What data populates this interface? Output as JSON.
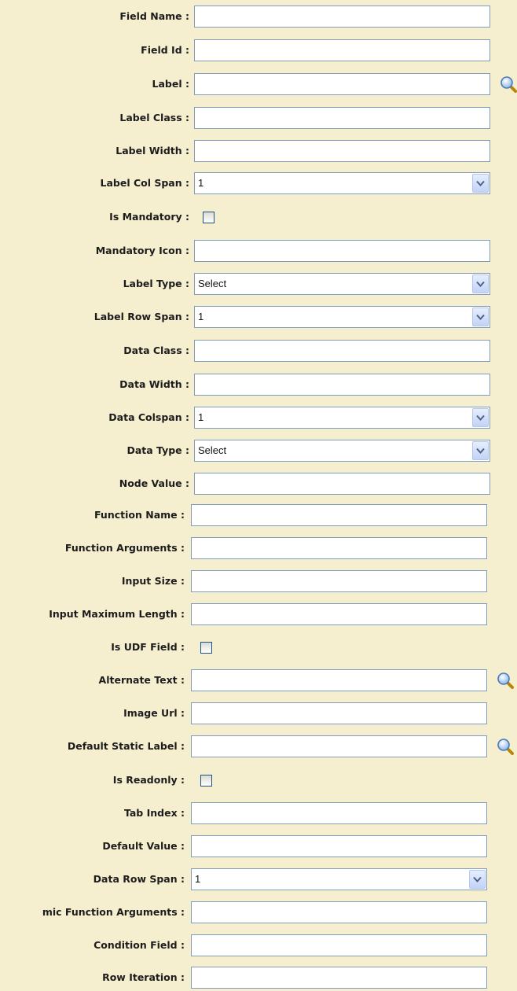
{
  "form": {
    "field_name": {
      "label": "Field Name :",
      "value": ""
    },
    "field_id": {
      "label": "Field Id :",
      "value": ""
    },
    "label": {
      "label": "Label :",
      "value": ""
    },
    "label_class": {
      "label": "Label Class :",
      "value": ""
    },
    "label_width": {
      "label": "Label Width :",
      "value": ""
    },
    "label_col_span": {
      "label": "Label Col Span :",
      "value": "1"
    },
    "is_mandatory": {
      "label": "Is Mandatory :",
      "checked": false
    },
    "mandatory_icon": {
      "label": "Mandatory Icon :",
      "value": ""
    },
    "label_type": {
      "label": "Label Type :",
      "value": "Select"
    },
    "label_row_span": {
      "label": "Label Row Span :",
      "value": "1"
    },
    "data_class": {
      "label": "Data Class :",
      "value": ""
    },
    "data_width": {
      "label": "Data Width :",
      "value": ""
    },
    "data_colspan": {
      "label": "Data Colspan :",
      "value": "1"
    },
    "data_type": {
      "label": "Data Type :",
      "value": "Select"
    },
    "node_value": {
      "label": "Node Value :",
      "value": ""
    },
    "function_name": {
      "label": "Function Name :",
      "value": ""
    },
    "function_arguments": {
      "label": "Function Arguments :",
      "value": ""
    },
    "input_size": {
      "label": "Input Size :",
      "value": ""
    },
    "input_max_length": {
      "label": "Input Maximum Length :",
      "value": ""
    },
    "is_udf_field": {
      "label": "Is UDF Field :",
      "checked": false
    },
    "alternate_text": {
      "label": "Alternate Text :",
      "value": ""
    },
    "image_url": {
      "label": "Image Url :",
      "value": ""
    },
    "default_static_label": {
      "label": "Default Static Label :",
      "value": ""
    },
    "is_readonly": {
      "label": "Is Readonly :",
      "checked": false
    },
    "tab_index": {
      "label": "Tab Index :",
      "value": ""
    },
    "default_value": {
      "label": "Default Value :",
      "value": ""
    },
    "data_row_span": {
      "label": "Data Row Span :",
      "value": "1"
    },
    "dynamic_function_arguments": {
      "label": "mic Function Arguments :",
      "value": ""
    },
    "condition_field": {
      "label": "Condition Field :",
      "value": ""
    },
    "row_iteration": {
      "label": "Row Iteration :",
      "value": ""
    }
  },
  "icons": {
    "lookup": "magnifier-icon",
    "dropdown": "chevron-down-icon"
  },
  "colors": {
    "background": "#f6efcf",
    "field_border": "#7f9db9",
    "checkbox_border": "#1c5180"
  }
}
